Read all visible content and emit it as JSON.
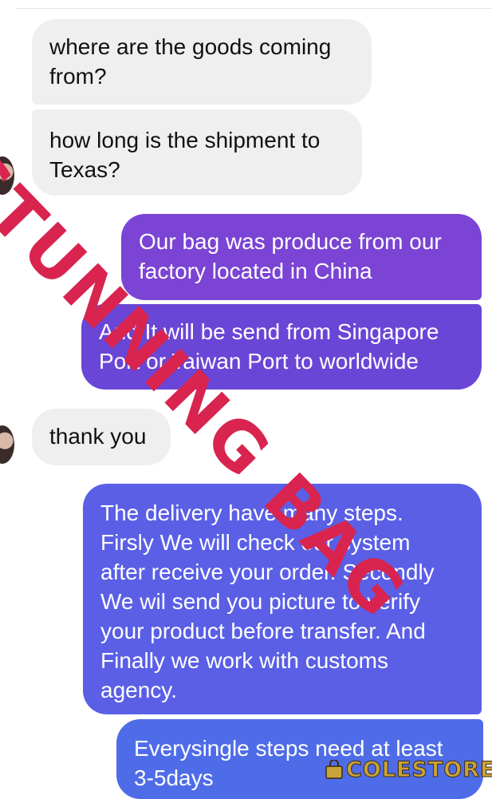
{
  "messages": [
    {
      "id": "b1",
      "direction": "incoming",
      "text": "where are the goods coming\nfrom?"
    },
    {
      "id": "b2",
      "direction": "incoming",
      "text": "how long is the shipment to\nTexas?"
    },
    {
      "id": "b3",
      "direction": "outgoing",
      "text": "Our bag was produce from our\nfactory located in China"
    },
    {
      "id": "b4",
      "direction": "outgoing",
      "text": "And It will be send from Singapore\nPort or Taiwan Port to worldwide"
    },
    {
      "id": "b5",
      "direction": "incoming",
      "text": "thank you"
    },
    {
      "id": "b6",
      "direction": "outgoing",
      "text": "The delivery have many steps.\nFirsly We will check our system\nafter receive your order. Secondly\nWe wil send you picture to verify\nyour product before transfer. And\nFinally we work with customs\nagency."
    },
    {
      "id": "b7",
      "direction": "outgoing",
      "text": "Everysingle steps need at least\n3-5days"
    }
  ],
  "watermark": {
    "text": "STUNNING BAG",
    "color": "#d8244f"
  },
  "logo": {
    "text": "COLESTORE",
    "icon": "shopping-bag-icon",
    "color": "#c9a33a"
  },
  "colors": {
    "incoming_bubble": "#efefef",
    "outgoing_bubble_1": "#7b44d4",
    "outgoing_bubble_2": "#6a46d6",
    "outgoing_bubble_3": "#5a5fe6",
    "outgoing_bubble_4": "#4f6ce8"
  }
}
